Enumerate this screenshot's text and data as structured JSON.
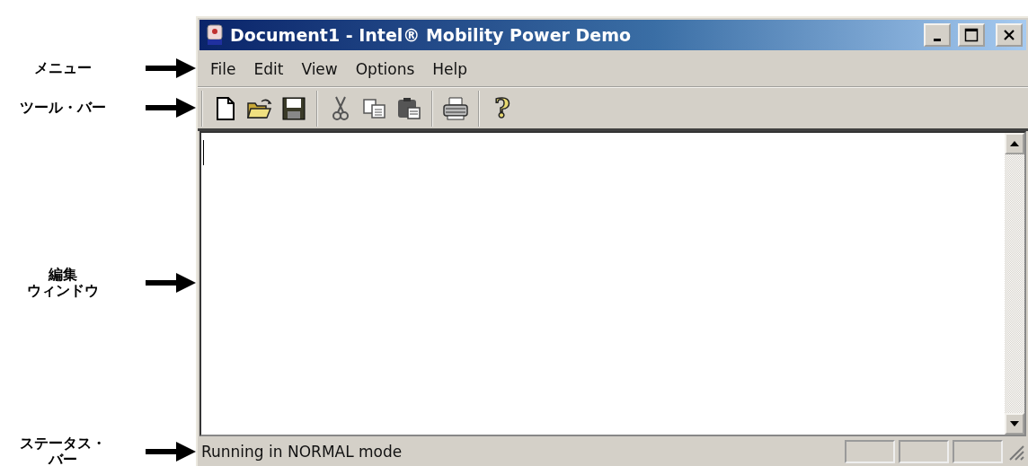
{
  "annotations": [
    {
      "lines": [
        "メニュー"
      ]
    },
    {
      "lines": [
        "ツール・バー"
      ]
    },
    {
      "lines": [
        "編集",
        "ウィンドウ"
      ]
    },
    {
      "lines": [
        "ステータス・",
        "バー"
      ]
    }
  ],
  "window": {
    "title": "Document1 - Intel® Mobility Power Demo"
  },
  "menu": [
    "File",
    "Edit",
    "View",
    "Options",
    "Help"
  ],
  "toolbar": {
    "groups": [
      [
        {
          "kind": "new"
        },
        {
          "kind": "open"
        },
        {
          "kind": "save"
        }
      ],
      [
        {
          "kind": "cut"
        },
        {
          "kind": "copy"
        },
        {
          "kind": "paste"
        }
      ],
      [
        {
          "kind": "print"
        }
      ],
      [
        {
          "kind": "help",
          "glyph": "?"
        }
      ]
    ]
  },
  "status_bar": {
    "message": "Running in NORMAL mode"
  }
}
